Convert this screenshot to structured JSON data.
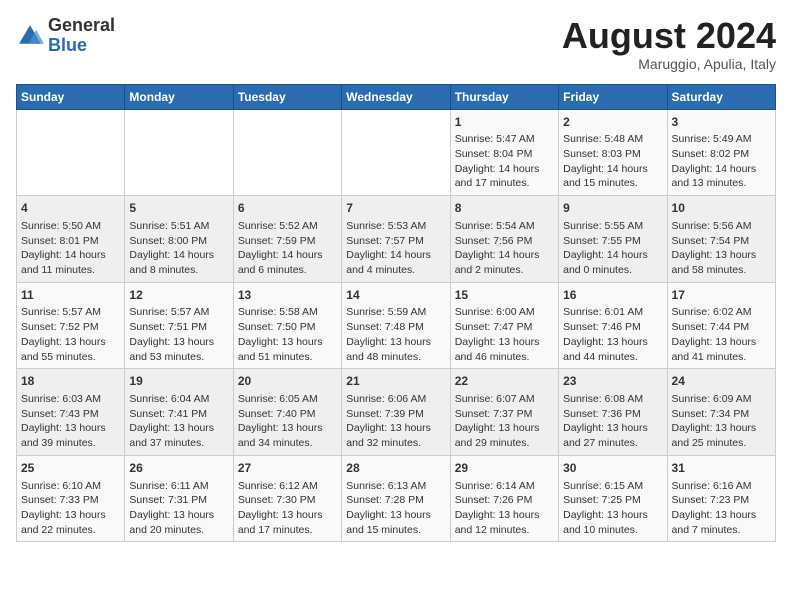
{
  "logo": {
    "general": "General",
    "blue": "Blue"
  },
  "title": "August 2024",
  "subtitle": "Maruggio, Apulia, Italy",
  "days_of_week": [
    "Sunday",
    "Monday",
    "Tuesday",
    "Wednesday",
    "Thursday",
    "Friday",
    "Saturday"
  ],
  "weeks": [
    [
      {
        "day": "",
        "info": ""
      },
      {
        "day": "",
        "info": ""
      },
      {
        "day": "",
        "info": ""
      },
      {
        "day": "",
        "info": ""
      },
      {
        "day": "1",
        "info": "Sunrise: 5:47 AM\nSunset: 8:04 PM\nDaylight: 14 hours\nand 17 minutes."
      },
      {
        "day": "2",
        "info": "Sunrise: 5:48 AM\nSunset: 8:03 PM\nDaylight: 14 hours\nand 15 minutes."
      },
      {
        "day": "3",
        "info": "Sunrise: 5:49 AM\nSunset: 8:02 PM\nDaylight: 14 hours\nand 13 minutes."
      }
    ],
    [
      {
        "day": "4",
        "info": "Sunrise: 5:50 AM\nSunset: 8:01 PM\nDaylight: 14 hours\nand 11 minutes."
      },
      {
        "day": "5",
        "info": "Sunrise: 5:51 AM\nSunset: 8:00 PM\nDaylight: 14 hours\nand 8 minutes."
      },
      {
        "day": "6",
        "info": "Sunrise: 5:52 AM\nSunset: 7:59 PM\nDaylight: 14 hours\nand 6 minutes."
      },
      {
        "day": "7",
        "info": "Sunrise: 5:53 AM\nSunset: 7:57 PM\nDaylight: 14 hours\nand 4 minutes."
      },
      {
        "day": "8",
        "info": "Sunrise: 5:54 AM\nSunset: 7:56 PM\nDaylight: 14 hours\nand 2 minutes."
      },
      {
        "day": "9",
        "info": "Sunrise: 5:55 AM\nSunset: 7:55 PM\nDaylight: 14 hours\nand 0 minutes."
      },
      {
        "day": "10",
        "info": "Sunrise: 5:56 AM\nSunset: 7:54 PM\nDaylight: 13 hours\nand 58 minutes."
      }
    ],
    [
      {
        "day": "11",
        "info": "Sunrise: 5:57 AM\nSunset: 7:52 PM\nDaylight: 13 hours\nand 55 minutes."
      },
      {
        "day": "12",
        "info": "Sunrise: 5:57 AM\nSunset: 7:51 PM\nDaylight: 13 hours\nand 53 minutes."
      },
      {
        "day": "13",
        "info": "Sunrise: 5:58 AM\nSunset: 7:50 PM\nDaylight: 13 hours\nand 51 minutes."
      },
      {
        "day": "14",
        "info": "Sunrise: 5:59 AM\nSunset: 7:48 PM\nDaylight: 13 hours\nand 48 minutes."
      },
      {
        "day": "15",
        "info": "Sunrise: 6:00 AM\nSunset: 7:47 PM\nDaylight: 13 hours\nand 46 minutes."
      },
      {
        "day": "16",
        "info": "Sunrise: 6:01 AM\nSunset: 7:46 PM\nDaylight: 13 hours\nand 44 minutes."
      },
      {
        "day": "17",
        "info": "Sunrise: 6:02 AM\nSunset: 7:44 PM\nDaylight: 13 hours\nand 41 minutes."
      }
    ],
    [
      {
        "day": "18",
        "info": "Sunrise: 6:03 AM\nSunset: 7:43 PM\nDaylight: 13 hours\nand 39 minutes."
      },
      {
        "day": "19",
        "info": "Sunrise: 6:04 AM\nSunset: 7:41 PM\nDaylight: 13 hours\nand 37 minutes."
      },
      {
        "day": "20",
        "info": "Sunrise: 6:05 AM\nSunset: 7:40 PM\nDaylight: 13 hours\nand 34 minutes."
      },
      {
        "day": "21",
        "info": "Sunrise: 6:06 AM\nSunset: 7:39 PM\nDaylight: 13 hours\nand 32 minutes."
      },
      {
        "day": "22",
        "info": "Sunrise: 6:07 AM\nSunset: 7:37 PM\nDaylight: 13 hours\nand 29 minutes."
      },
      {
        "day": "23",
        "info": "Sunrise: 6:08 AM\nSunset: 7:36 PM\nDaylight: 13 hours\nand 27 minutes."
      },
      {
        "day": "24",
        "info": "Sunrise: 6:09 AM\nSunset: 7:34 PM\nDaylight: 13 hours\nand 25 minutes."
      }
    ],
    [
      {
        "day": "25",
        "info": "Sunrise: 6:10 AM\nSunset: 7:33 PM\nDaylight: 13 hours\nand 22 minutes."
      },
      {
        "day": "26",
        "info": "Sunrise: 6:11 AM\nSunset: 7:31 PM\nDaylight: 13 hours\nand 20 minutes."
      },
      {
        "day": "27",
        "info": "Sunrise: 6:12 AM\nSunset: 7:30 PM\nDaylight: 13 hours\nand 17 minutes."
      },
      {
        "day": "28",
        "info": "Sunrise: 6:13 AM\nSunset: 7:28 PM\nDaylight: 13 hours\nand 15 minutes."
      },
      {
        "day": "29",
        "info": "Sunrise: 6:14 AM\nSunset: 7:26 PM\nDaylight: 13 hours\nand 12 minutes."
      },
      {
        "day": "30",
        "info": "Sunrise: 6:15 AM\nSunset: 7:25 PM\nDaylight: 13 hours\nand 10 minutes."
      },
      {
        "day": "31",
        "info": "Sunrise: 6:16 AM\nSunset: 7:23 PM\nDaylight: 13 hours\nand 7 minutes."
      }
    ]
  ]
}
